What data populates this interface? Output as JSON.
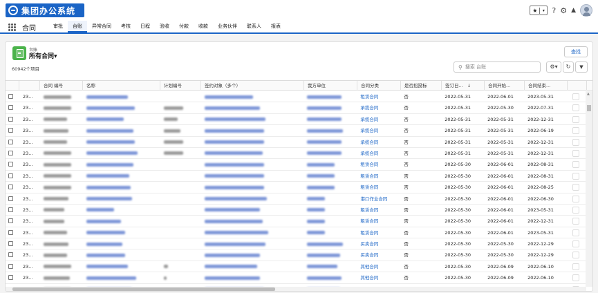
{
  "header": {
    "logo_text": "集团办公系统",
    "icons": [
      "star-icon",
      "help-icon",
      "gear-icon",
      "bell-icon",
      "avatar"
    ],
    "fav_star": "★",
    "fav_dropdown": "▾",
    "help": "?",
    "gear": "⚙",
    "bell": "🔔"
  },
  "nav": {
    "app_name": "合同",
    "tabs": [
      "审批",
      "台账",
      "异常合同",
      "考核",
      "日程",
      "验收",
      "付款",
      "收款",
      "业务伙伴",
      "联系人",
      "报表"
    ],
    "active_tab": "台账"
  },
  "list": {
    "object_label": "台账",
    "view_name": "所有合同",
    "view_caret": "▾",
    "item_count": "60942个项目",
    "find_button": "查找",
    "search_placeholder": "搜索 台账",
    "settings_glyph": "⚙▾",
    "refresh_glyph": "↻",
    "filter_glyph": "▼"
  },
  "columns": [
    "",
    "",
    "合同 编号",
    "名称",
    "计划编号",
    "签约对象（多个）",
    "我方单位",
    "合同分类",
    "是否招投标",
    "签订日...",
    "合同开始...",
    "合同结束...",
    ""
  ],
  "sort_indicator": "↓",
  "colors": {
    "brand": "#1a64c6",
    "link": "#1a64c6",
    "success": "#4bb34b"
  },
  "rows": [
    {
      "num": "23...",
      "category": "租赁合同",
      "bid": "否",
      "signed": "2022-05-31",
      "start": "2022-06-01",
      "end": "2023-05-31"
    },
    {
      "num": "23...",
      "category": "承揽合同",
      "bid": "否",
      "signed": "2022-05-31",
      "start": "2022-05-30",
      "end": "2022-07-31"
    },
    {
      "num": "23...",
      "category": "承揽合同",
      "bid": "否",
      "signed": "2022-05-31",
      "start": "2022-05-31",
      "end": "2022-12-31"
    },
    {
      "num": "23...",
      "category": "承揽合同",
      "bid": "否",
      "signed": "2022-05-31",
      "start": "2022-05-31",
      "end": "2022-06-19"
    },
    {
      "num": "23...",
      "category": "承揽合同",
      "bid": "否",
      "signed": "2022-05-31",
      "start": "2022-05-31",
      "end": "2022-12-31"
    },
    {
      "num": "23...",
      "category": "承揽合同",
      "bid": "否",
      "signed": "2022-05-31",
      "start": "2022-05-31",
      "end": "2022-12-31"
    },
    {
      "num": "23...",
      "category": "租赁合同",
      "bid": "否",
      "signed": "2022-05-30",
      "start": "2022-06-01",
      "end": "2022-08-31"
    },
    {
      "num": "23...",
      "category": "租赁合同",
      "bid": "否",
      "signed": "2022-05-30",
      "start": "2022-06-01",
      "end": "2022-08-31"
    },
    {
      "num": "23...",
      "category": "租赁合同",
      "bid": "否",
      "signed": "2022-05-30",
      "start": "2022-06-01",
      "end": "2022-08-25"
    },
    {
      "num": "23...",
      "category": "港口作业合同",
      "bid": "否",
      "signed": "2022-05-30",
      "start": "2022-06-01",
      "end": "2022-06-30"
    },
    {
      "num": "23...",
      "category": "租赁合同",
      "bid": "否",
      "signed": "2022-05-30",
      "start": "2022-06-01",
      "end": "2023-05-31"
    },
    {
      "num": "23...",
      "category": "租赁合同",
      "bid": "否",
      "signed": "2022-05-30",
      "start": "2022-06-01",
      "end": "2022-12-31"
    },
    {
      "num": "23...",
      "category": "租赁合同",
      "bid": "否",
      "signed": "2022-05-30",
      "start": "2022-06-01",
      "end": "2023-05-31"
    },
    {
      "num": "23...",
      "category": "买卖合同",
      "bid": "否",
      "signed": "2022-05-30",
      "start": "2022-05-30",
      "end": "2022-12-29"
    },
    {
      "num": "23...",
      "category": "买卖合同",
      "bid": "否",
      "signed": "2022-05-30",
      "start": "2022-05-30",
      "end": "2022-12-29"
    },
    {
      "num": "23...",
      "category": "其他合同",
      "bid": "否",
      "signed": "2022-05-30",
      "start": "2022-06-09",
      "end": "2022-06-10"
    },
    {
      "num": "23...",
      "category": "其他合同",
      "bid": "否",
      "signed": "2022-05-30",
      "start": "2022-06-09",
      "end": "2022-06-10"
    },
    {
      "num": "23...",
      "category": "其他合同",
      "bid": "否",
      "signed": "2022-05-30",
      "start": "2022-06-07",
      "end": "2022-06-08"
    }
  ]
}
